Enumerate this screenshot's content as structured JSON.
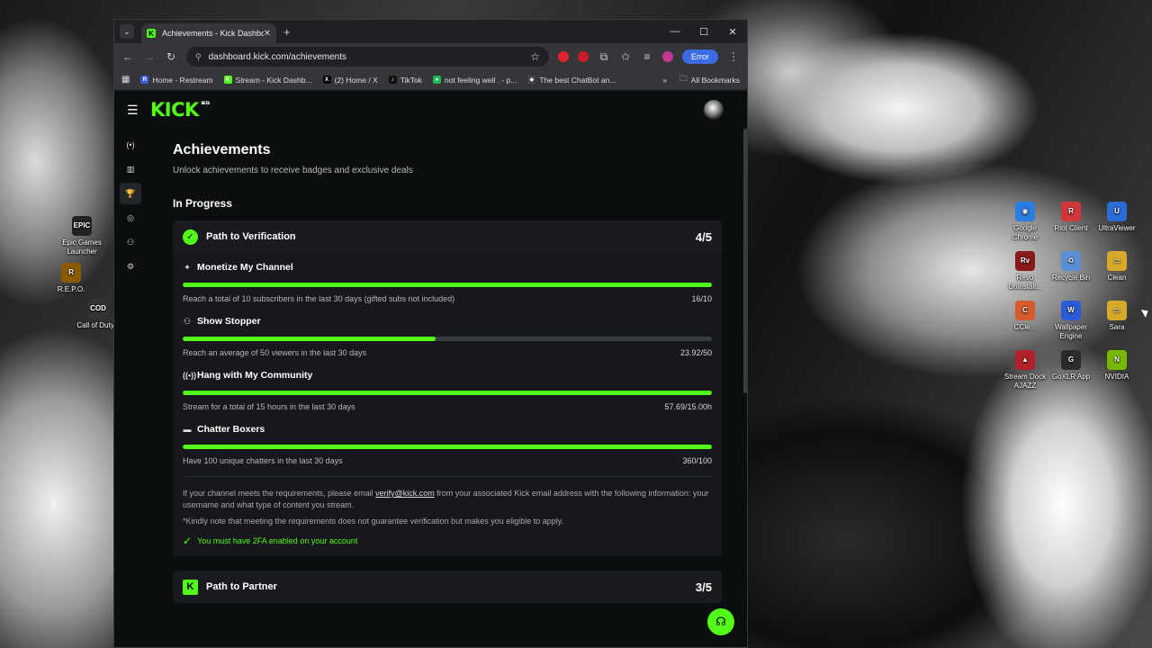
{
  "window": {
    "tab_title": "Achievements - Kick Dashboard",
    "url": "dashboard.kick.com/achievements",
    "error_label": "Error"
  },
  "bookmarks": [
    {
      "label": "Home - Restream",
      "color": "#3b5bdb",
      "glyph": "R"
    },
    {
      "label": "Stream - Kick Dashb...",
      "color": "#53fc18",
      "glyph": "K"
    },
    {
      "label": "(2) Home / X",
      "color": "#000000",
      "glyph": "X"
    },
    {
      "label": "TikTok",
      "color": "#111111",
      "glyph": "♪"
    },
    {
      "label": "not feeling well . - p...",
      "color": "#1db954",
      "glyph": "●"
    },
    {
      "label": "The best ChatBot an...",
      "color": "#444444",
      "glyph": "◆"
    }
  ],
  "bookmarks_overflow": "»",
  "all_bookmarks": "All Bookmarks",
  "page": {
    "title": "Achievements",
    "subtitle": "Unlock achievements to receive badges and exclusive deals",
    "section": "In Progress"
  },
  "verification": {
    "title": "Path to Verification",
    "count": "4/5",
    "requirements": [
      {
        "name": "Monetize My Channel",
        "icon": "sparkle-icon",
        "glyph": "✦",
        "desc": "Reach a total of 10 subscribers in the last 30 days (gifted subs not included)",
        "value": "16/10",
        "progress": 1.0
      },
      {
        "name": "Show Stopper",
        "icon": "users-icon",
        "glyph": "⚇",
        "desc": "Reach an average of 50 viewers in the last 30 days",
        "value": "23.92/50",
        "progress": 0.4784
      },
      {
        "name": "Hang with My Community",
        "icon": "broadcast-icon",
        "glyph": "((•))",
        "desc": "Stream for a total of 15 hours in the last 30 days",
        "value": "57.69/15.00h",
        "progress": 1.0
      },
      {
        "name": "Chatter Boxers",
        "icon": "chat-icon",
        "glyph": "▬",
        "desc": "Have 100 unique chatters in the last 30 days",
        "value": "360/100",
        "progress": 1.0
      }
    ],
    "note_prefix": "If your channel meets the requirements, please email ",
    "note_email": "verify@kick.com",
    "note_suffix": " from your associated Kick email address with the following information: your username and what type of content you stream.",
    "disclaimer": "*Kindly note that meeting the requirements does not guarantee verification but makes you eligible to apply.",
    "twofa": "You must have 2FA enabled on your account"
  },
  "partner": {
    "title": "Path to Partner",
    "count": "3/5"
  },
  "desktop_icons": [
    {
      "label": "Epic Games Launcher",
      "color": "#222222",
      "glyph": "EPIC"
    },
    {
      "label": "R.E.P.O.",
      "color": "#8a5a00",
      "glyph": "R"
    },
    {
      "label": "Call of Duty®",
      "color": "#333333",
      "glyph": "COD"
    },
    {
      "label": "Google Chrome",
      "color": "#2a7de1",
      "glyph": "◉"
    },
    {
      "label": "Riot Client",
      "color": "#d13639",
      "glyph": "R"
    },
    {
      "label": "UltraViewer",
      "color": "#2b6cd6",
      "glyph": "U"
    },
    {
      "label": "Revo Uninstall...",
      "color": "#8a1a1a",
      "glyph": "Rv"
    },
    {
      "label": "Recycle Bin",
      "color": "#5a8fd6",
      "glyph": "♻"
    },
    {
      "label": "Clean",
      "color": "#d6a92b",
      "glyph": "▭"
    },
    {
      "label": "CCle...",
      "color": "#d65a2b",
      "glyph": "C"
    },
    {
      "label": "Wallpaper Engine",
      "color": "#2b5ad6",
      "glyph": "W"
    },
    {
      "label": "Sara",
      "color": "#d6a92b",
      "glyph": "▭"
    },
    {
      "label": "Stream Dock AJAZZ",
      "color": "#b1212b",
      "glyph": "▲"
    },
    {
      "label": "GoXLR App",
      "color": "#2b2b2b",
      "glyph": "G"
    },
    {
      "label": "NVIDIA",
      "color": "#76b900",
      "glyph": "N"
    }
  ]
}
